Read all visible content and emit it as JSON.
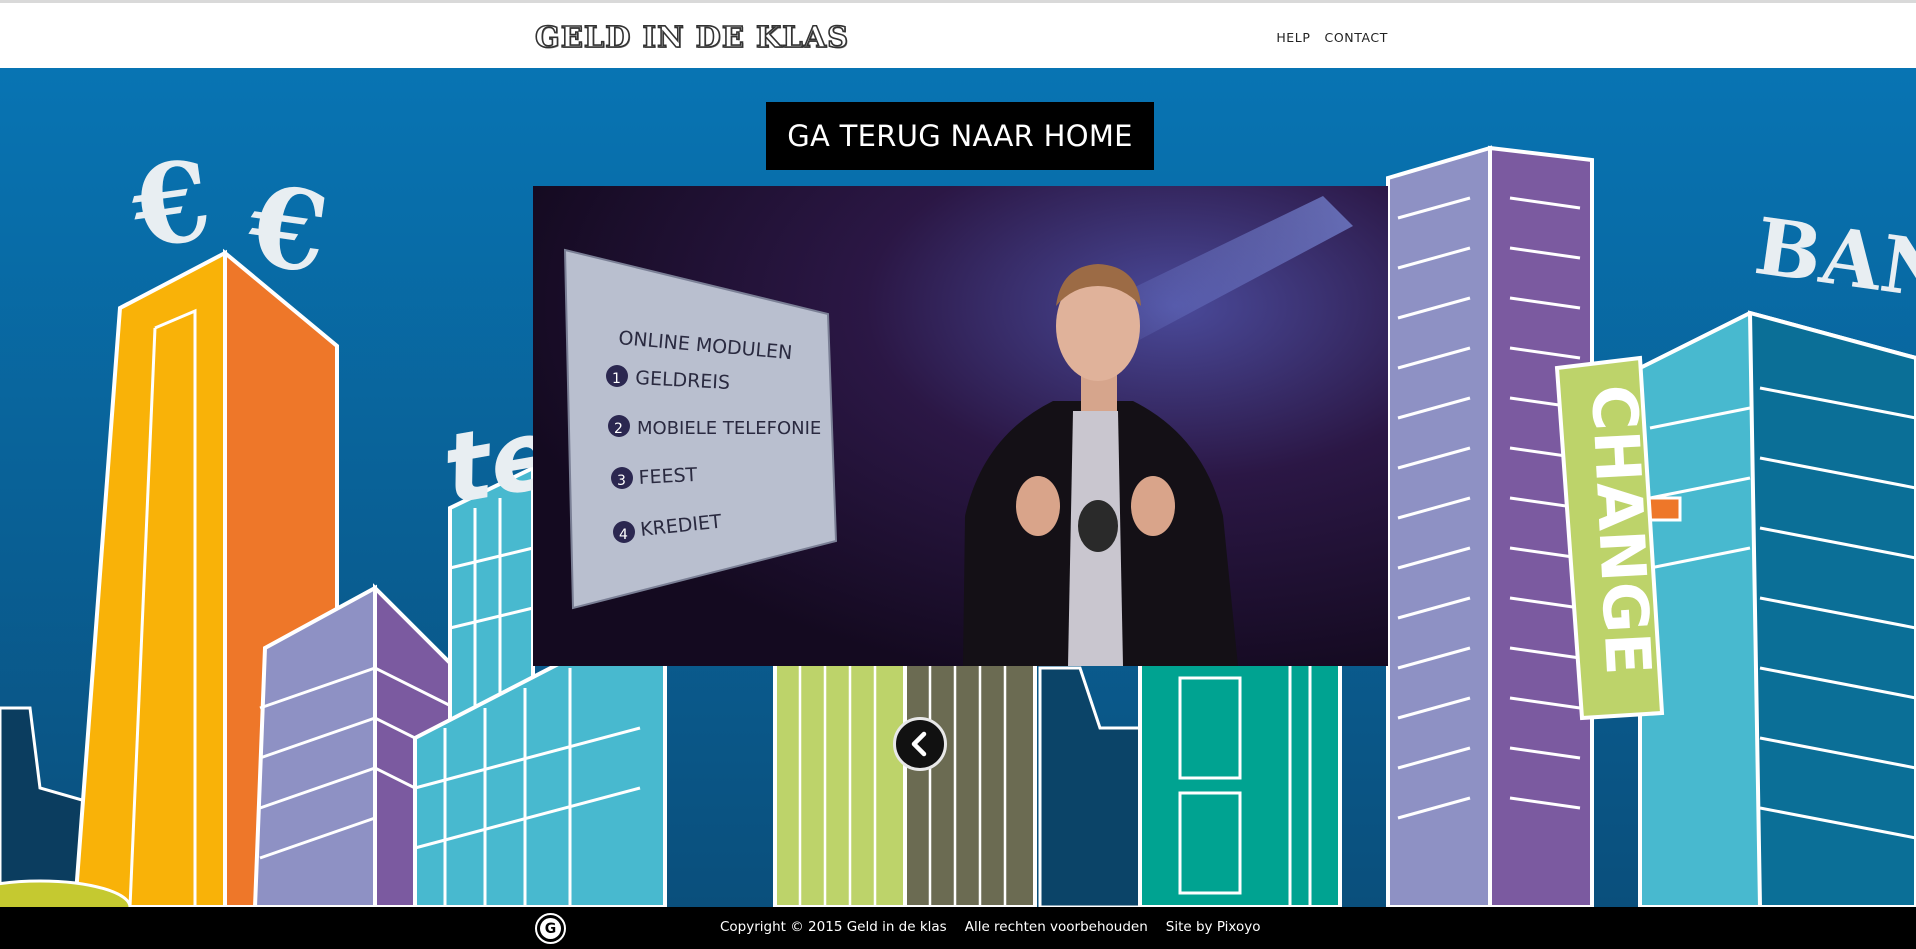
{
  "header": {
    "logo_text": "GELD IN DE KLAS",
    "nav": [
      {
        "label": "HELP"
      },
      {
        "label": "CONTACT"
      }
    ]
  },
  "hero": {
    "home_button_label": "GA TERUG NAAR HOME",
    "back_icon": "chevron-left-icon",
    "illustration_signs": {
      "euro_1": "€",
      "euro_2": "€",
      "tel": "tel",
      "bank": "BAN",
      "change": "CHANGE"
    }
  },
  "video": {
    "board_title": "ONLINE MODULEN",
    "modules": [
      {
        "num": "1",
        "label": "GELDREIS"
      },
      {
        "num": "2",
        "label": "MOBIELE TELEFONIE"
      },
      {
        "num": "3",
        "label": "FEEST"
      },
      {
        "num": "4",
        "label": "KREDIET"
      }
    ]
  },
  "footer": {
    "logo_letter": "G",
    "copyright": "Copyright © 2015 Geld in de klas",
    "rights": "Alle rechten voorbehouden",
    "credit": "Site by Pixoyo"
  },
  "colors": {
    "sky": "#0a6aa4",
    "orange": "#ee7729",
    "yellow": "#f9b208",
    "lavender": "#8e91c4",
    "purple": "#7b5aa0",
    "cyan": "#48b9cf",
    "lime": "#bdd36a",
    "teal": "#00a391"
  }
}
